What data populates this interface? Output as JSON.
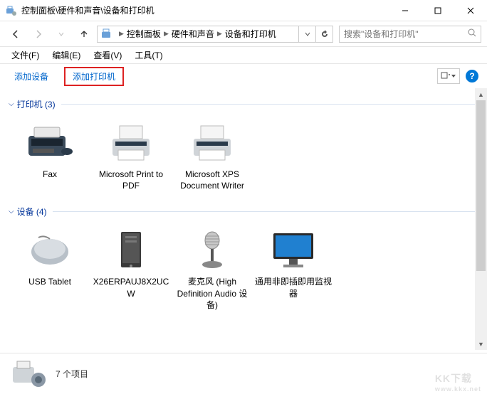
{
  "window": {
    "title": "控制面板\\硬件和声音\\设备和打印机"
  },
  "breadcrumbs": {
    "items": [
      "控制面板",
      "硬件和声音",
      "设备和打印机"
    ]
  },
  "search": {
    "placeholder": "搜索\"设备和打印机\""
  },
  "menubar": {
    "items": [
      "文件(F)",
      "编辑(E)",
      "查看(V)",
      "工具(T)"
    ]
  },
  "toolbar": {
    "add_device": "添加设备",
    "add_printer": "添加打印机"
  },
  "groups": {
    "printers": {
      "title": "打印机 (3)",
      "items": [
        {
          "label": "Fax",
          "icon": "fax"
        },
        {
          "label": "Microsoft Print to PDF",
          "icon": "printer"
        },
        {
          "label": "Microsoft XPS Document Writer",
          "icon": "printer"
        }
      ]
    },
    "devices": {
      "title": "设备 (4)",
      "items": [
        {
          "label": "USB Tablet",
          "icon": "mouse"
        },
        {
          "label": "X26ERPAUJ8X2UCW",
          "icon": "pc"
        },
        {
          "label": "麦克风 (High Definition Audio 设备)",
          "icon": "mic"
        },
        {
          "label": "通用非即插即用监视器",
          "icon": "monitor"
        }
      ]
    }
  },
  "statusbar": {
    "text": "7 个项目"
  },
  "help_glyph": "?",
  "watermark": {
    "top": "KK下载",
    "bottom": "www.kkx.net"
  }
}
